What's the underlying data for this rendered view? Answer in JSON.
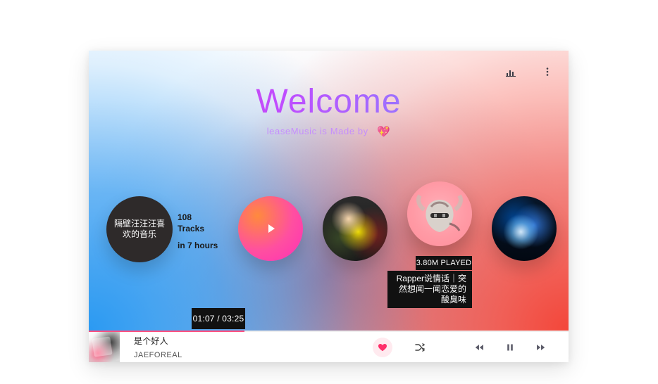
{
  "colors": {
    "accent_pink": "#ff4f7f",
    "dark_tooltip": "#111111",
    "title_gradient_left": "#e04cc8",
    "title_gradient_right": "#6aa7ff"
  },
  "header": {
    "title": "Welcome",
    "subtitle": "leaseMusic  is  Made  by",
    "heart_glyph": "💖"
  },
  "top_icons": {
    "stats_icon": "bar-chart-icon",
    "menu_icon": "more-vertical-icon"
  },
  "carousel": {
    "playlist": {
      "title": "隔壁汪汪汪喜欢的音乐",
      "tracks_count": "108",
      "tracks_label": "Tracks",
      "duration": "in 7 hours"
    },
    "hover_card": {
      "played": "3.80M PLAYED",
      "title": "Rapper说情话｜突然想闻一闻恋爱的酸臭味"
    }
  },
  "player": {
    "time_tooltip": "01:07 / 03:25",
    "progress_fraction": 0.325,
    "song_title": "是个好人",
    "artist": "JAEFOREAL",
    "liked": true
  }
}
